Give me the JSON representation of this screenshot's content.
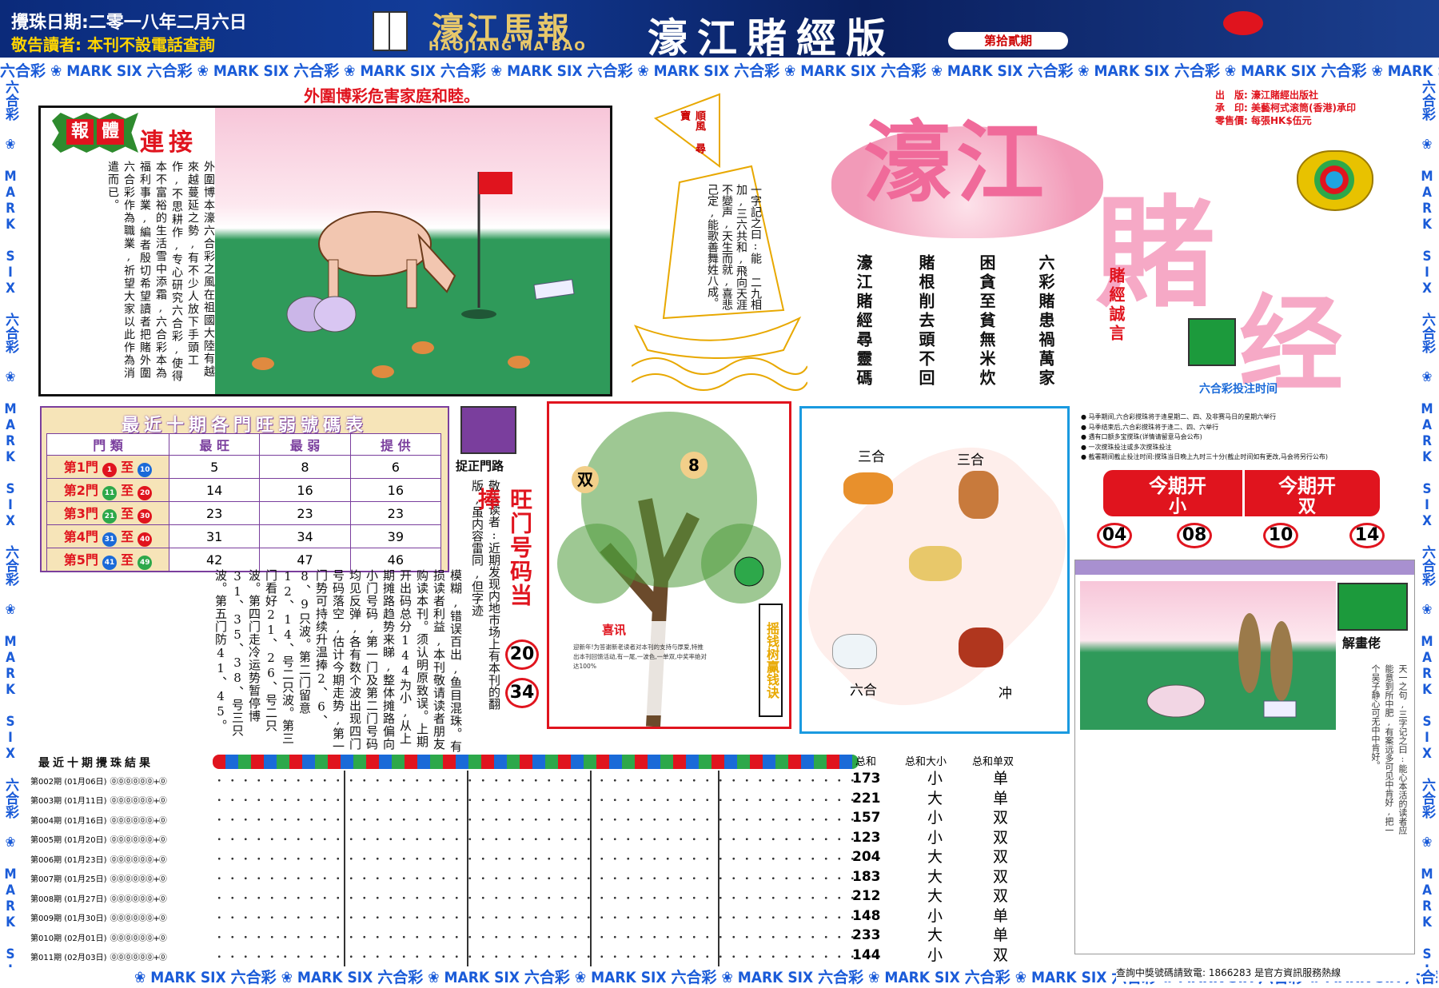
{
  "header": {
    "draw_date": "攪珠日期:二零一八年二月六日",
    "notice": "敬告讀者: 本刊不設電話查詢",
    "logo_cn": "濠江馬報",
    "logo_en": "HAOJIANG MA BAO",
    "edition_title": "濠江賭經版",
    "issue_no": "第拾貳期"
  },
  "strip": {
    "text": "六合彩 ❀ MARK SIX 六合彩 ❀ MARK SIX 六合彩 ❀ MARK SIX 六合彩 ❀ MARK SIX 六合彩 ❀ MARK SIX 六合彩 ❀ MARK SIX 六合彩 ❀ MARK SIX 六合彩 ❀ MARK SIX 六合彩 ❀ MARK SIX 六合彩 ❀ MARK SIX",
    "bottom_text": "❀ MARK SIX 六合彩 ❀ MARK SIX 六合彩 ❀ MARK SIX 六合彩 ❀ MARK SIX 六合彩 ❀ MARK SIX 六合彩 ❀ MARK SIX 六合彩 ❀ MARK SIX 六合彩 ❀ MARK SIX 六合彩 ❀ MARK SIX 六合彩 ❀ MARK SIX"
  },
  "headline": "外圍博彩危害家庭和睦。",
  "article": {
    "badge_1": "報",
    "badge_2": "體",
    "badge_3": "連接",
    "text": "外圍博本濠六合彩之風在祖國大陸有越來越蔓延之勢,有不少人放下手頭工作,不思耕作,专心研究六合彩,使得本不富裕的生活雪中添霜,六合彩本為福利事業,編者殷切希望讀者把賭外圍六合彩作為職業,祈望大家以此作為消遣而已。"
  },
  "boat": {
    "flag_text": "順風 尋寶",
    "riddle": "一字記之曰:能 二九相加,三六共和,飛向天涯不變声,天生而就,喜悲己定,能歌善舞姓八成。"
  },
  "masthead": {
    "publisher": "出　版: 濠江賭經出版社",
    "printer": "承　印: 美藝柯式滚筒(香港)承印",
    "price": "零售價: 每張HK$伍元",
    "big_1": "濠江",
    "big_2": "賭",
    "big_3": "经",
    "motto_label": "賭經誠言",
    "poem": [
      "六彩賭患禍萬家",
      "困貪至貧無米炊",
      "賭根削去頭不回",
      "濠江賭經尋靈碼"
    ],
    "time_label": "六合彩投注时间"
  },
  "rules": [
    "● 马季期间,六合彩搅珠将于逢星期二、四、及非赛马日的星期六举行",
    "● 马季结束后,六合彩搅珠将于逢二、四、六举行",
    "● 遇有口额多宝搅珠(详情请留意马会公布)",
    "● 一次搅珠投注或多次搅珠投注",
    "● 截署期间截止投注时间:搅珠当日晚上九时三十分(截止时间如有更改,马会将另行公布)"
  ],
  "this_period": {
    "label_1": "今期开",
    "value_1": "小",
    "label_2": "今期开",
    "value_2": "双",
    "balls": [
      "04",
      "08",
      "10",
      "14"
    ]
  },
  "ranking": {
    "title": "最近十期各門旺弱號碼表",
    "headers": [
      "門 類",
      "最 旺",
      "最 弱",
      "提 供"
    ],
    "rows": [
      {
        "gate": "第1門",
        "from": "1",
        "to": "10",
        "hot": "5",
        "cold": "8",
        "tip": "6"
      },
      {
        "gate": "第2門",
        "from": "11",
        "to": "20",
        "hot": "14",
        "cold": "16",
        "tip": "16"
      },
      {
        "gate": "第3門",
        "from": "21",
        "to": "30",
        "hot": "23",
        "cold": "23",
        "tip": "23"
      },
      {
        "gate": "第4門",
        "from": "31",
        "to": "40",
        "hot": "31",
        "cold": "34",
        "tip": "39"
      },
      {
        "gate": "第5門",
        "from": "41",
        "to": "49",
        "hot": "42",
        "cold": "47",
        "tip": "46"
      }
    ],
    "zhi": "至"
  },
  "gate_label": "捉正門路",
  "analysis": "模糊,错误百出,鱼目混珠。有损读者利益,本刊敬请读者朋友购读本刊。须认明原致误。上期开出码总分144为小,从上期摊路趋势来睇,整体摊路偏向小门号码,第一门及第二门号码均见反弹,各有数个波出现四门号码落空,估计今期走势,第一门势可持续升温捧2、6、8、9只波。第二门留意12、14、号二只波。第三门看好21、26、号二只波。第四门走冷运势暂停博31、35、38、号三只波。第五门防41、45。",
  "warning": "敬告读者:近期发现内地市场上有本刊的翻版,虽内容雷同,但字迹",
  "hot_gate": {
    "title": "旺门号码当捧",
    "balls": [
      "20",
      "34"
    ]
  },
  "tree": {
    "tag_1": "双",
    "tag_2": "8",
    "xixun_title": "喜讯",
    "xixun_text": "迎新年!为答谢新老读者对本刊的支持与厚爱,特推出本刊回馈活动,有一尾,一波色,一单双,中奖率绝对达100%",
    "side": "摇钱树赢钱诀"
  },
  "zodiac": {
    "label_tl": "三合",
    "label_tr": "三合",
    "label_bl": "六合",
    "label_br": "冲"
  },
  "picture_puzzle": {
    "label": "解畫佬",
    "text": "天一之句,三字记之曰:能心本活的读者应能意到所中肥,有案远多可见中肯好,把一个吴子静心可无中中肯好。"
  },
  "results": {
    "title": "最近十期攪珠結果",
    "rows": [
      {
        "label": "第002期 (01月06日)",
        "total": "173",
        "size": "小",
        "parity": "单"
      },
      {
        "label": "第003期 (01月11日)",
        "total": "221",
        "size": "大",
        "parity": "单"
      },
      {
        "label": "第004期 (01月16日)",
        "total": "157",
        "size": "小",
        "parity": "双"
      },
      {
        "label": "第005期 (01月20日)",
        "total": "123",
        "size": "小",
        "parity": "双"
      },
      {
        "label": "第006期 (01月23日)",
        "total": "204",
        "size": "大",
        "parity": "双"
      },
      {
        "label": "第007期 (01月25日)",
        "total": "183",
        "size": "大",
        "parity": "双"
      },
      {
        "label": "第008期 (01月27日)",
        "total": "212",
        "size": "大",
        "parity": "双"
      },
      {
        "label": "第009期 (01月30日)",
        "total": "148",
        "size": "小",
        "parity": "单"
      },
      {
        "label": "第010期 (02月01日)",
        "total": "233",
        "size": "大",
        "parity": "单"
      },
      {
        "label": "第011期 (02月03日)",
        "total": "144",
        "size": "小",
        "parity": "双"
      }
    ],
    "headers": [
      "总和",
      "总和大小",
      "总和单双"
    ]
  },
  "footer": "查詢中獎號碼請致電: 1866283 是官方資訊服務熱線"
}
